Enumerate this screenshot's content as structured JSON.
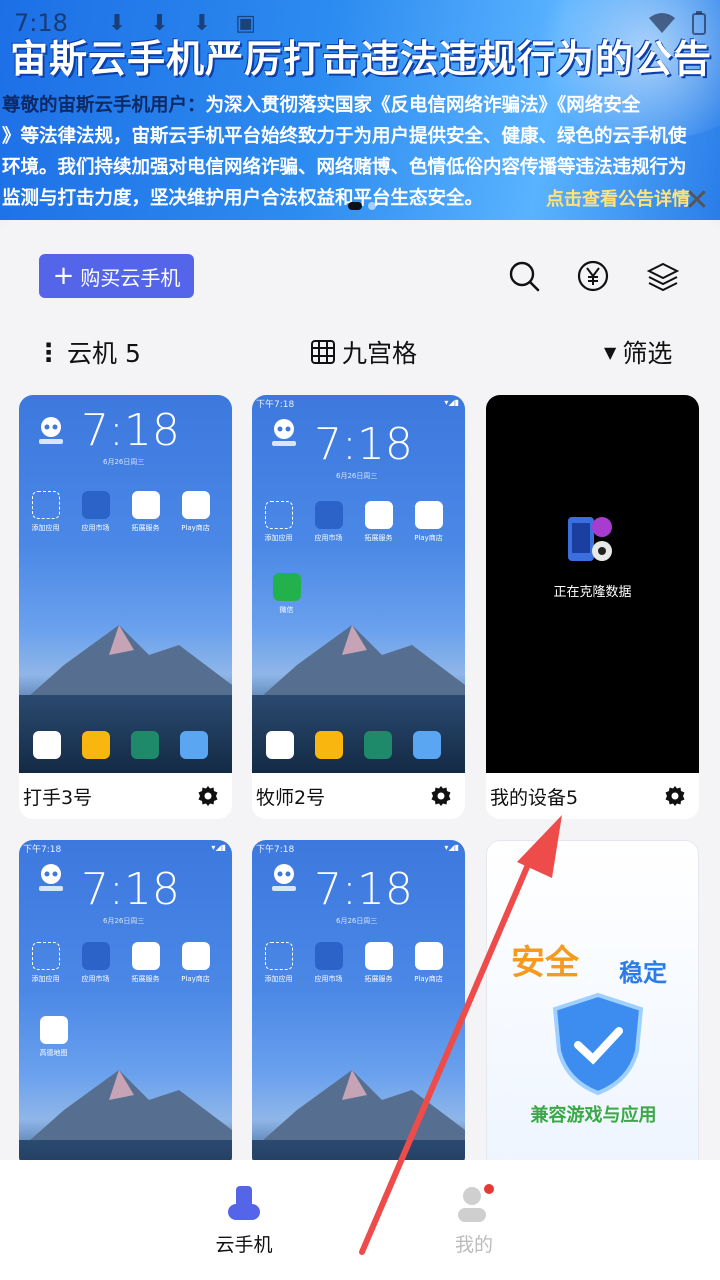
{
  "status_bar": {
    "time": "7:18"
  },
  "banner": {
    "title": "宙斯云手机严厉打击违法违规行为的公告",
    "lead": "尊敬的宙斯云手机用户：",
    "line1_rest": "为深入贯彻落实国家《反电信网络诈骗法》《网络安全",
    "line2": "》等法律法规，宙斯云手机平台始终致力于为用户提供安全、健康、绿色的云手机使",
    "line3": "环境。我们持续加强对电信网络诈骗、网络赌博、色情低俗内容传播等违法违规行为",
    "line4": "监测与打击力度，坚决维护用户合法权益和平台生态安全。",
    "link": "点击查看公告详情",
    "close_icon": "close-icon"
  },
  "toolbar": {
    "buy_label": "购买云手机",
    "icons": [
      "search-icon",
      "yuan-icon",
      "layers-icon"
    ]
  },
  "filterbar": {
    "group_label": "云机 5",
    "layout_label": "九宫格",
    "filter_label": "筛选"
  },
  "phone": {
    "time": "7:18",
    "status_time": "下午7:18",
    "date": "6月26日周三",
    "apps": [
      "添加应用",
      "应用市场",
      "拓展服务",
      "Play商店"
    ],
    "wechat": "微信",
    "amap": "高德地图",
    "cloning": "正在克隆数据"
  },
  "devices": [
    {
      "name": "打手3号"
    },
    {
      "name": "牧师2号"
    },
    {
      "name": "我的设备5"
    }
  ],
  "ad_card": {
    "safe": "安全",
    "stable": "稳定",
    "compat": "兼容游戏与应用"
  },
  "nav": {
    "cloud_phone": "云手机",
    "mine": "我的",
    "active_color": "#5565ea",
    "inactive_color": "#bbbbbb",
    "badge_color": "#e53935"
  },
  "colors": {
    "accent": "#5565ea",
    "arrow": "#ee4b4b"
  }
}
